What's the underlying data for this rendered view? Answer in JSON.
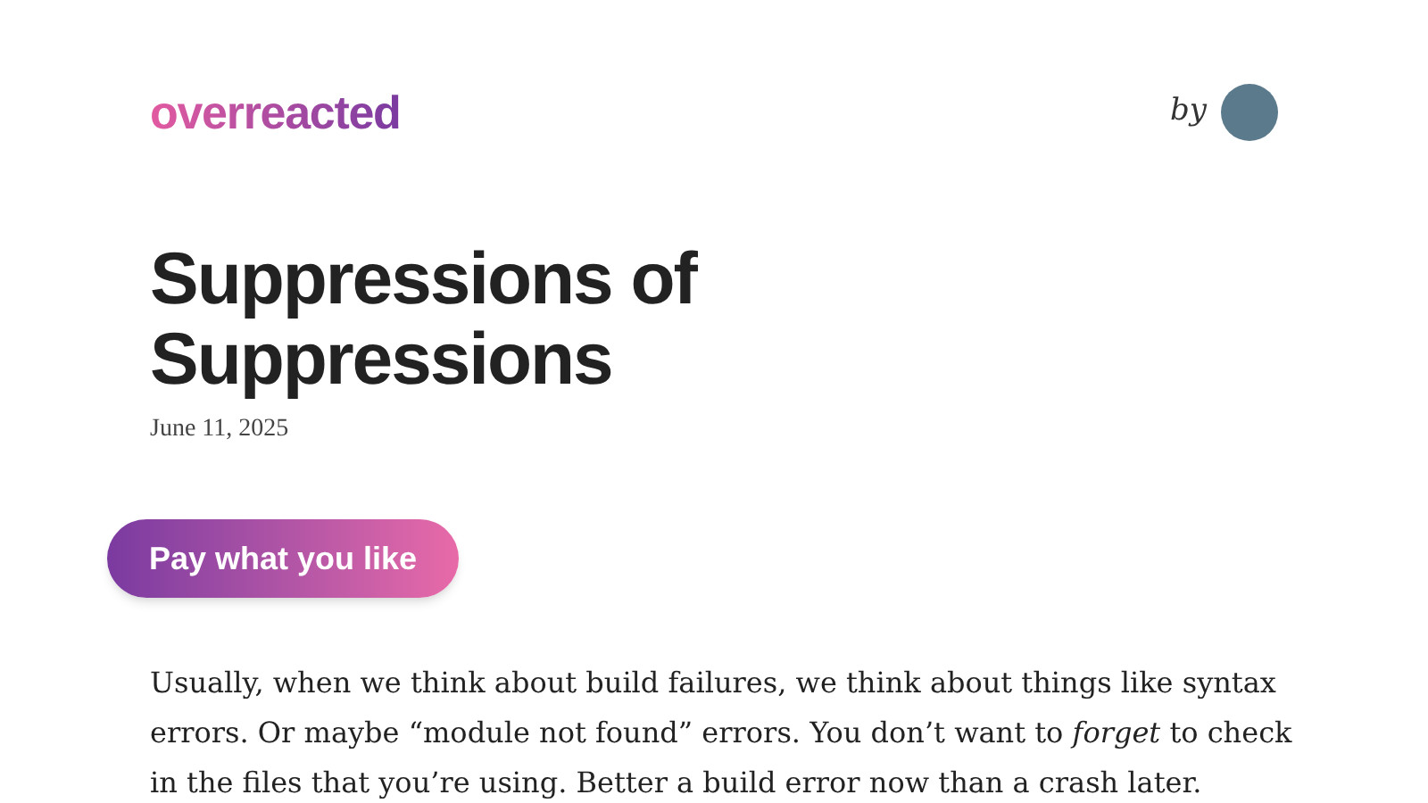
{
  "header": {
    "logo": "overreacted",
    "byline": "by"
  },
  "post": {
    "title": "Suppressions of Suppressions",
    "date": "June 11, 2025"
  },
  "pay_button": {
    "label": "Pay what you like"
  },
  "body": [
    "Usually, when we think about build failures, we think about things like syntax errors. Or maybe “module not found” errors. You don’t want to *forget* to check in the files that you’re using. Better a build error now than a crash later."
  ]
}
